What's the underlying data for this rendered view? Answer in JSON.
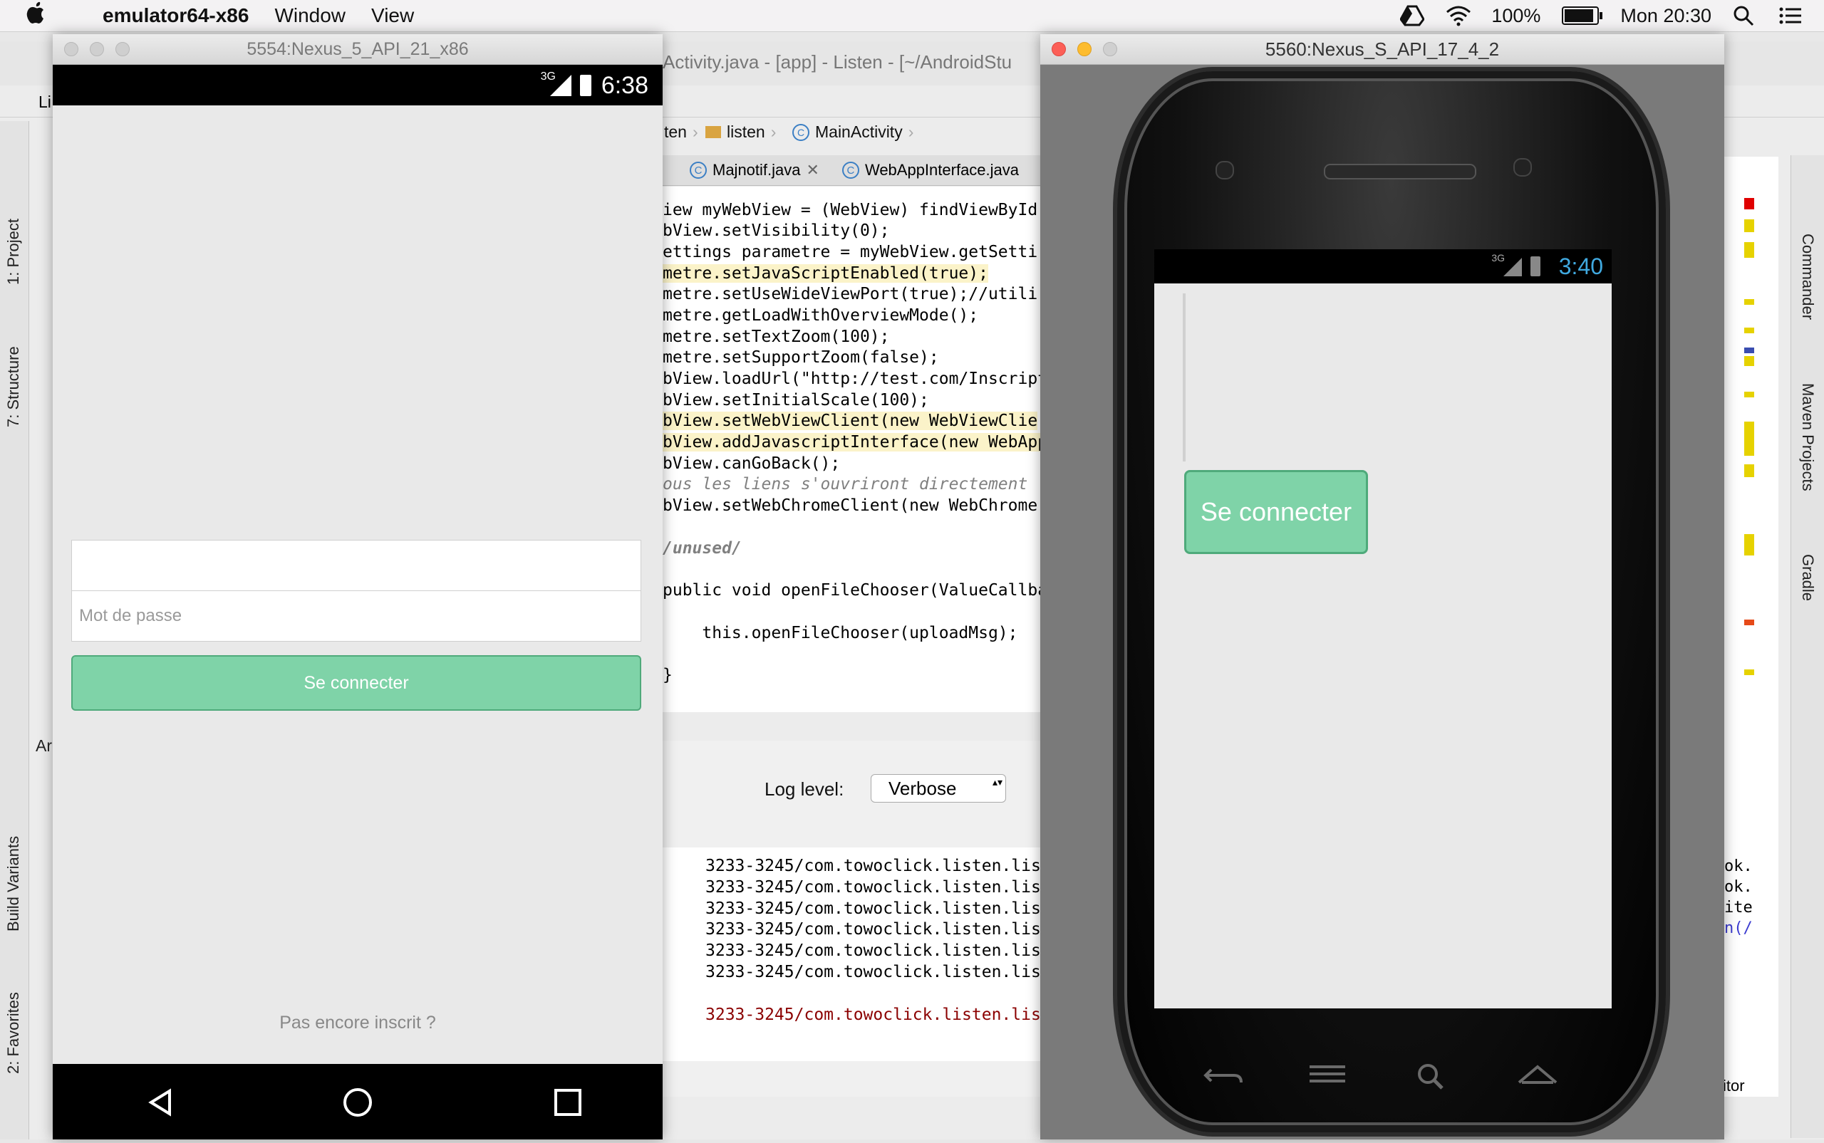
{
  "menubar": {
    "app_name": "emulator64-x86",
    "menus": [
      "Window",
      "View"
    ],
    "battery_text": "100%",
    "battery_level": 1.0,
    "clock": "Mon 20:30"
  },
  "studio": {
    "title_fragment": "Activity.java - [app] - Listen - [~/AndroidStu",
    "breadcrumb": [
      "ten",
      "listen",
      "MainActivity"
    ],
    "tabs": [
      "Majnotif.java",
      "WebAppInterface.java"
    ],
    "left_tabs": [
      "1: Project",
      "7: Structure",
      "Build Variants",
      "2: Favorites"
    ],
    "right_tabs": [
      "Commander",
      "Maven Projects",
      "Gradle"
    ],
    "left_fragment_1": "Li",
    "left_fragment_2": "Ar",
    "right_fragment": "itor",
    "code_lines": [
      "iew myWebView = (WebView) findViewById(",
      "bView.setVisibility(0);",
      "ettings parametre = myWebView.getSetti",
      "metre.setJavaScriptEnabled(true);",
      "metre.setUseWideViewPort(true);//utili",
      "metre.getLoadWithOverviewMode();",
      "metre.setTextZoom(100);",
      "metre.setSupportZoom(false);",
      "bView.loadUrl(\"http://test.com/Inscript",
      "bView.setInitialScale(100);",
      "bView.setWebViewClient(new WebViewClie",
      "bView.addJavascriptInterface(new WebApp",
      "bView.canGoBack();",
      "ous les liens s'ouvriront directement",
      "bView.setWebChromeClient(new WebChrome(",
      "/unused/",
      "public void openFileChooser(ValueCallba",
      "    this.openFileChooser(uploadMsg);",
      "}"
    ],
    "log_level_label": "Log level:",
    "log_level_value": "Verbose",
    "log_lines": [
      "3233-3245/com.towoclick.listen.lis",
      "3233-3245/com.towoclick.listen.lis",
      "3233-3245/com.towoclick.listen.lis",
      "3233-3245/com.towoclick.listen.lis",
      "3233-3245/com.towoclick.listen.lis",
      "3233-3245/com.towoclick.listen.lis",
      "3233-3245/com.towoclick.listen.lis"
    ],
    "log_right_fragments": [
      "ok.",
      "ok.",
      "ite",
      "n(/"
    ]
  },
  "emulator1": {
    "title": "5554:Nexus_5_API_21_x86",
    "network": "3G",
    "time": "6:38",
    "password_placeholder": "Mot de passe",
    "connect_label": "Se connecter",
    "signup_link": "Pas encore inscrit ?"
  },
  "emulator2": {
    "title": "5560:Nexus_S_API_17_4_2",
    "network": "3G",
    "time": "3:40",
    "connect_label": "Se connecter"
  },
  "colors": {
    "button_green": "#7fd3a8",
    "button_border": "#4faa7b",
    "status_time_blue": "#40a9e0"
  }
}
